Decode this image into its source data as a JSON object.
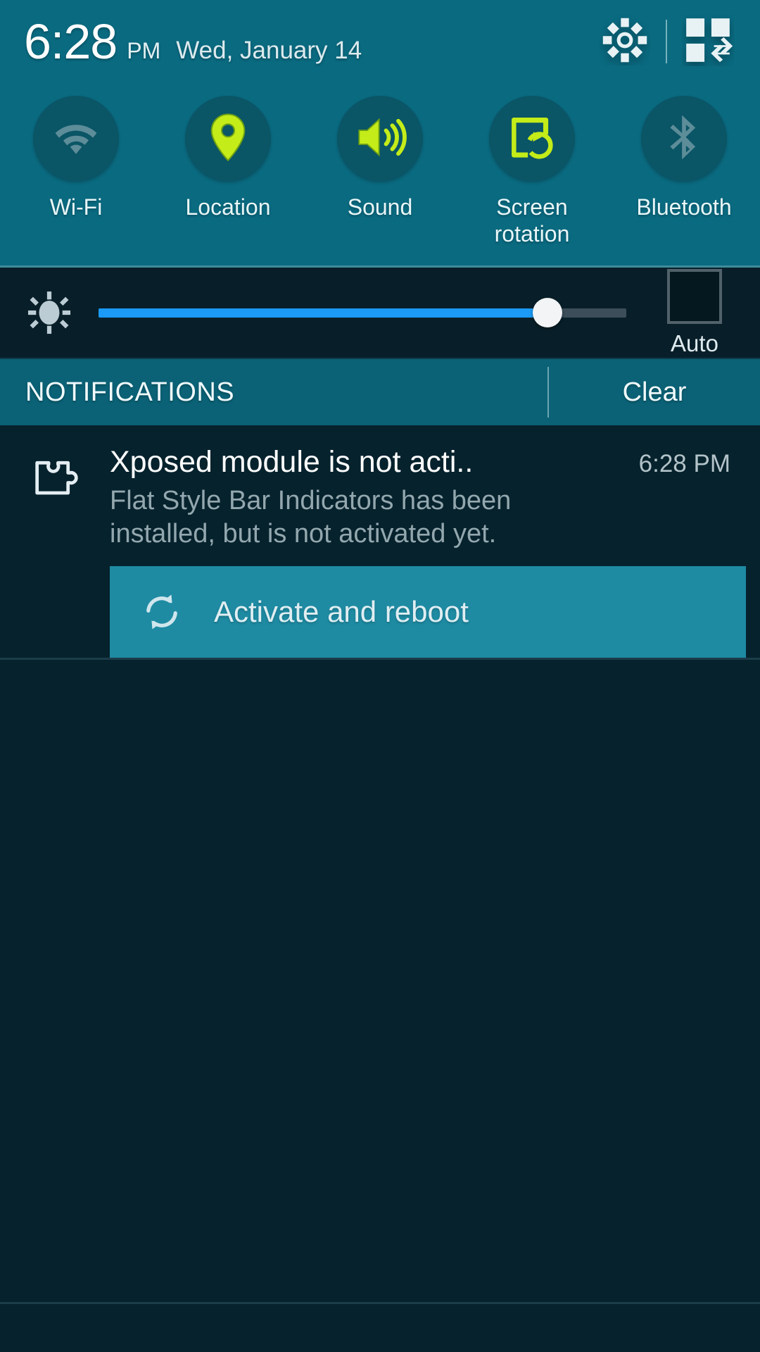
{
  "status_bar": {
    "time": "6:28",
    "ampm": "PM",
    "date": "Wed, January 14",
    "settings_icon": "gear-icon",
    "quick_settings_icon": "quick-settings-grid-icon"
  },
  "quick_toggles": [
    {
      "label": "Wi-Fi",
      "icon": "wifi-icon",
      "state": "off"
    },
    {
      "label": "Location",
      "icon": "location-pin-icon",
      "state": "on"
    },
    {
      "label": "Sound",
      "icon": "speaker-icon",
      "state": "on"
    },
    {
      "label": "Screen rotation",
      "icon": "screen-rotation-icon",
      "state": "on"
    },
    {
      "label": "Bluetooth",
      "icon": "bluetooth-icon",
      "state": "off"
    }
  ],
  "brightness": {
    "icon": "brightness-sun-icon",
    "value_percent": 85,
    "auto_label": "Auto",
    "auto_checked": false
  },
  "notifications_bar": {
    "title": "NOTIFICATIONS",
    "clear_label": "Clear"
  },
  "notification": {
    "icon": "puzzle-piece-icon",
    "heading": "Xposed module is not acti..",
    "time": "6:28 PM",
    "text": "Flat Style Bar Indicators has been installed, but is not activated yet.",
    "action": {
      "icon": "sync-refresh-icon",
      "label": "Activate and reboot"
    }
  },
  "colors": {
    "panel_teal": "#0a6a80",
    "toggle_circle": "#0a5566",
    "toggle_on": "#c3ec19",
    "toggle_off": "#5d8d99",
    "slider_blue": "#1b9af7",
    "notif_bar": "#0b6276",
    "action_teal": "#1e8ba3",
    "background": "#06222d"
  }
}
